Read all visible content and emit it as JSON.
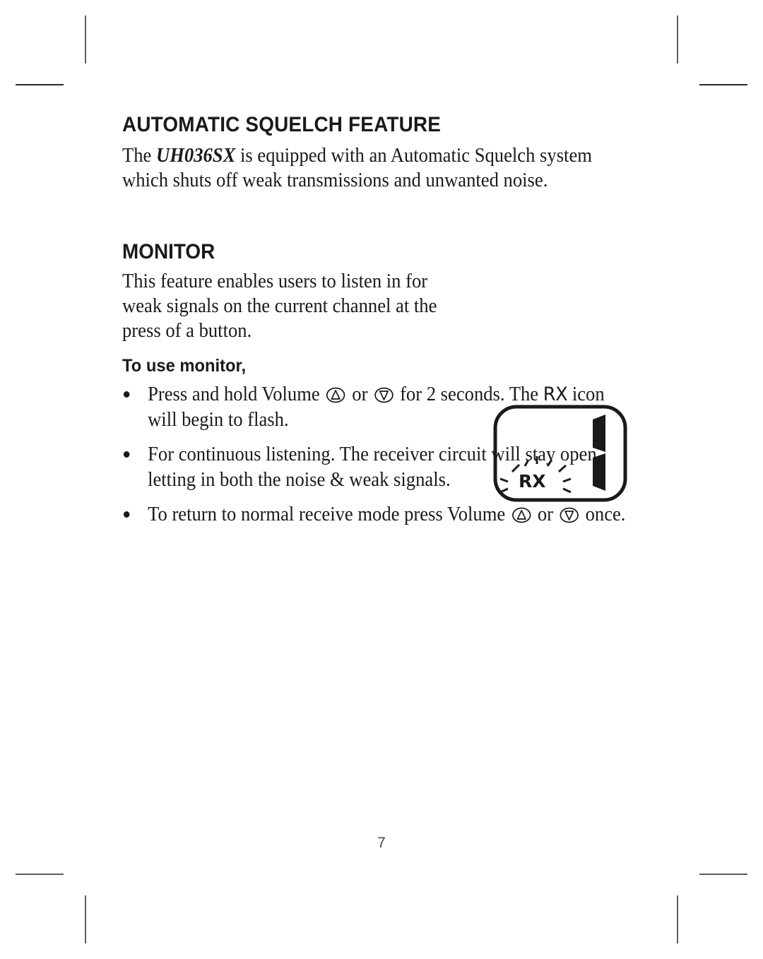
{
  "document": {
    "page_number": "7",
    "text_color": "#1a1a1a",
    "background_color": "#ffffff",
    "crop_mark_color": "#5d5d5d"
  },
  "sections": {
    "squelch": {
      "heading": "AUTOMATIC SQUELCH FEATURE",
      "body_before_model": "The ",
      "model": "UH036SX",
      "body_after_model": " is equipped with an Automatic Squelch system which shuts off weak transmissions and unwanted noise."
    },
    "monitor": {
      "heading": "MONITOR",
      "description": "This feature enables users to listen in for weak signals on the current channel at the press of a button.",
      "subheading": "To use monitor,",
      "steps": [
        {
          "part1": "Press and hold Volume ",
          "key_up": "volume-up-key",
          "mid1": " or ",
          "key_down": "volume-down-key",
          "mid2": " for 2 seconds. The ",
          "rx": "RX",
          "part2": " icon will begin to flash."
        },
        {
          "part1": "For continuous listening. The receiver circuit will stay open, letting in both the noise & weak signals."
        },
        {
          "part1": "To return to normal receive mode press Volume ",
          "key_up": "volume-up-key",
          "mid1": " or ",
          "key_down": "volume-down-key",
          "part2": " once."
        }
      ]
    }
  },
  "lcd_illustration": {
    "name": "lcd-display-graphic",
    "outline_shape": "rounded-rectangle",
    "channel_digit": "1",
    "digit_style": "seven-segment",
    "indicator_label": "RX",
    "indicator_state": "flashing",
    "flash_ray_count": 8,
    "stroke_color": "#1a1a1a"
  },
  "icons": {
    "volume_up": "triangle-up-in-circle",
    "volume_down": "triangle-down-in-circle",
    "bullet": "filled-dot"
  },
  "crop_marks": [
    "top-left-vertical",
    "top-left-horizontal",
    "top-right-vertical",
    "top-right-horizontal",
    "bottom-left-horizontal",
    "bottom-left-vertical",
    "bottom-right-horizontal",
    "bottom-right-vertical"
  ]
}
